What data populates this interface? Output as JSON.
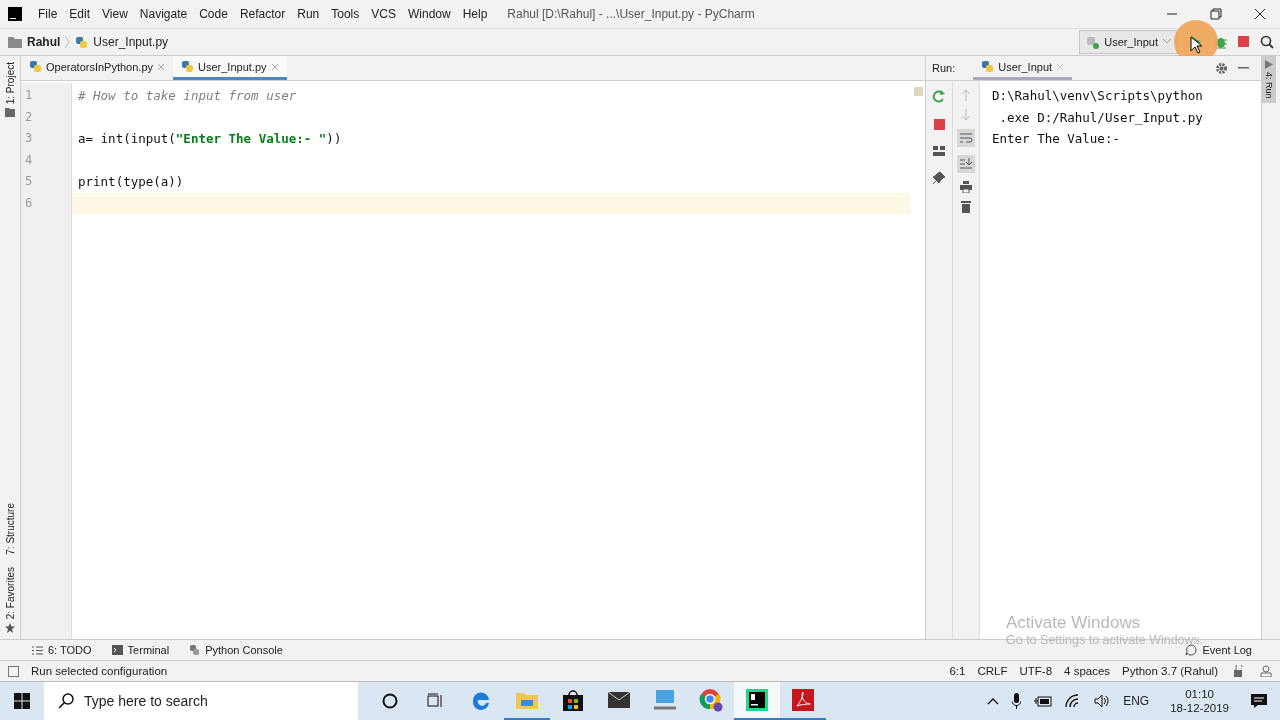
{
  "window": {
    "title": "Rahul [D:\\Rahul] - ...\\User_Input.py - PyCharm"
  },
  "menu": [
    "File",
    "Edit",
    "View",
    "Navigate",
    "Code",
    "Refactor",
    "Run",
    "Tools",
    "VCS",
    "Window",
    "Help"
  ],
  "breadcrumb": {
    "folder": "Rahul",
    "file": "User_Input.py"
  },
  "run_config": "User_Input",
  "left_strip": [
    "1: Project",
    "7: Structure",
    "2: Favorites"
  ],
  "right_strip": [
    "4: Run"
  ],
  "editor_tabs": [
    {
      "label": "OperatorsInPython.py",
      "selected": false
    },
    {
      "label": "User_Input.py",
      "selected": true
    }
  ],
  "code_lines": [
    {
      "number": "1",
      "current": false,
      "tokens": [
        {
          "text": "# How to take input from user",
          "kind": "comment"
        }
      ]
    },
    {
      "number": "2",
      "current": false
    },
    {
      "number": "3",
      "current": false,
      "tokens": [
        {
          "text": "a= int(input(",
          "kind": "plain"
        },
        {
          "text": "\"Enter The Value:- \"",
          "kind": "string"
        },
        {
          "text": "))",
          "kind": "plain"
        }
      ]
    },
    {
      "number": "4",
      "current": false
    },
    {
      "number": "5",
      "current": false,
      "tokens": [
        {
          "text": "print(type(a))",
          "kind": "plain"
        }
      ]
    },
    {
      "number": "6",
      "current": true
    }
  ],
  "run_panel": {
    "label": "Run:",
    "tab": "User_Input",
    "output": [
      "D:\\Rahul\\venv\\Scripts\\python",
      " .exe D:/Rahul/User_Input.py",
      "Enter The Value:-"
    ]
  },
  "os_notice": {
    "title": "Activate Windows",
    "subtitle": "Go to Settings to activate Windows."
  },
  "tool_tabs": [
    "6: TODO",
    "Terminal",
    "Python Console"
  ],
  "event_log": "Event Log",
  "status_bar": {
    "message": "Run selected configuration",
    "items": [
      "6:1",
      "CRLF",
      "UTF-8",
      "4 spaces",
      "Python 3.7 (Rahul)"
    ]
  },
  "taskbar": {
    "search_placeholder": "Type here to search",
    "apps": [
      {
        "kind": "edge",
        "running": false,
        "focused": false
      },
      {
        "kind": "explorer",
        "running": true,
        "focused": false
      },
      {
        "kind": "store",
        "running": false,
        "focused": false
      },
      {
        "kind": "mail",
        "running": false,
        "focused": false
      },
      {
        "kind": "computer",
        "running": false,
        "focused": false
      },
      {
        "kind": "chrome",
        "running": false,
        "focused": false
      },
      {
        "kind": "pycharm",
        "running": true,
        "focused": true
      },
      {
        "kind": "acrobat",
        "running": true,
        "focused": false
      }
    ],
    "language": "ENG",
    "time": "01:10",
    "date": "18-12-2019"
  }
}
